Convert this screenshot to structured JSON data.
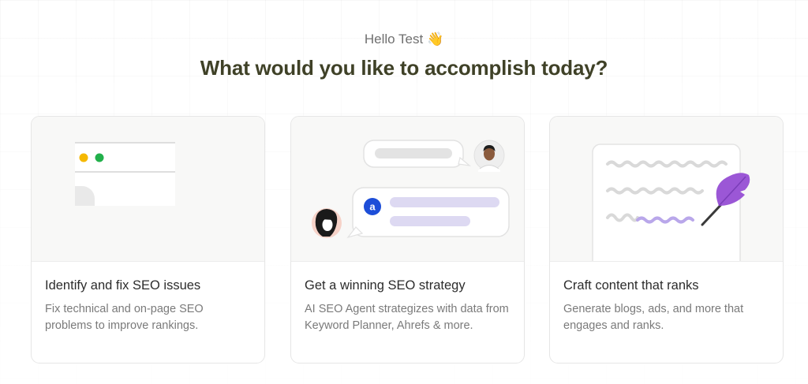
{
  "header": {
    "greeting": "Hello Test",
    "wave_emoji": "👋",
    "headline": "What would you like to accomplish today?"
  },
  "cards": [
    {
      "title": "Identify and fix SEO issues",
      "description": "Fix technical and on-page SEO problems to improve rankings.",
      "illustration": "browser-window-icon"
    },
    {
      "title": "Get a winning SEO strategy",
      "description": "AI SEO Agent strategizes with data from Keyword Planner, Ahrefs & more.",
      "illustration": "chat-conversation-icon",
      "assistant_badge": "a"
    },
    {
      "title": "Craft content that ranks",
      "description": "Generate blogs, ads, and more that engages and ranks.",
      "illustration": "feather-pen-icon"
    }
  ],
  "colors": {
    "headline": "#3f4127",
    "dot_yellow": "#f5b800",
    "dot_green": "#22b04b",
    "brand_blue": "#1d4ed8",
    "chat_lavender": "#ddd9f2",
    "feather_purple": "#9b57d6"
  }
}
